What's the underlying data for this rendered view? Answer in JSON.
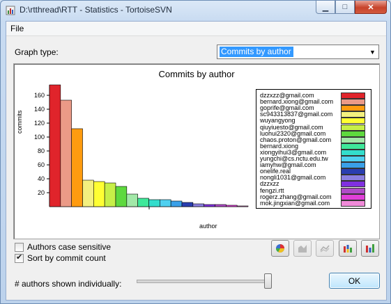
{
  "window": {
    "title": "D:\\rtthread\\RTT - Statistics - TortoiseSVN",
    "controls": {
      "minimize": "▁",
      "maximize": "□",
      "close": "✕"
    }
  },
  "menu": {
    "file": "File"
  },
  "graph_type": {
    "label": "Graph type:",
    "selected": "Commits by author"
  },
  "chart_data": {
    "type": "bar",
    "title": "Commits by author",
    "xlabel": "author",
    "ylabel": "commits",
    "yticks": [
      20,
      40,
      60,
      80,
      100,
      120,
      140,
      160
    ],
    "ylim": [
      0,
      175
    ],
    "legend_position": "right",
    "categories": [
      "dzzxzz@gmail.com",
      "bernard.xiong@gmail.com",
      "goprife@gmail.com",
      "sc943313837@gmail.com",
      "wuyangyong",
      "qiuyiuesto@gmail.com",
      "luohui2320@gmail.com",
      "chaos.proton@gmail.com",
      "bernard.xiong",
      "xiongyihui3@gmail.com",
      "yungchi@cs.nctu.edu.tw",
      "iamyhw@gmail.com",
      "onelife.real",
      "nongli1031@gmail.com",
      "dzzxzz",
      "fengzi.rtt",
      "rogerz.zhang@gmail.com",
      "mok.jingxian@gmail.com"
    ],
    "values": [
      175,
      153,
      112,
      38,
      36,
      34,
      29,
      18,
      12,
      10,
      10,
      8,
      6,
      4,
      3,
      3,
      2,
      1
    ],
    "colors": [
      "#e0242b",
      "#eb9a87",
      "#ff9b0f",
      "#f3f07f",
      "#ffff33",
      "#c7ef48",
      "#5ed93e",
      "#a2e8a8",
      "#3fe89a",
      "#33ddcc",
      "#4fd0f0",
      "#3aa0e8",
      "#2a3eb0",
      "#8b7fe0",
      "#8030e0",
      "#b04bc8",
      "#e040d8",
      "#f08ad8"
    ]
  },
  "options": {
    "case_sensitive_label": "Authors case sensitive",
    "case_sensitive_checked": false,
    "sort_label": "Sort by commit count",
    "sort_checked": true
  },
  "toolbar": {
    "pie": "pie-chart-icon",
    "area": "area-chart-icon",
    "lines": "line-chart-icon",
    "stacked_bar": "stacked-bar-chart-icon",
    "bar": "bar-chart-icon"
  },
  "slider": {
    "label": "# authors shown individually:",
    "position_fraction": 0.97
  },
  "ok_button": {
    "label": "OK"
  }
}
